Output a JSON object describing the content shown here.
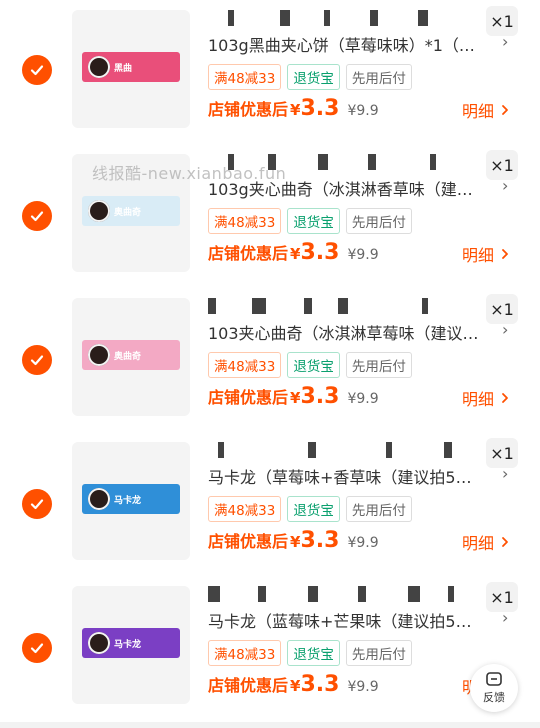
{
  "watermark": "线报酷-new.xianbao.fun",
  "feedback_label": "反馈",
  "items": [
    {
      "title": "103g黑曲夹心饼（草莓味味）*1（…",
      "qty": "×1",
      "tags": [
        "满48减33",
        "退货宝",
        "先用后付"
      ],
      "price_label": "店铺优惠后",
      "price_symbol": "¥",
      "price": "3.3",
      "original_price": "¥9.9",
      "detail": "明细",
      "pack_text": "黑曲",
      "pack_color": "#e94f7a"
    },
    {
      "title": "103g夹心曲奇（冰淇淋香草味（建…",
      "qty": "×1",
      "tags": [
        "满48减33",
        "退货宝",
        "先用后付"
      ],
      "price_label": "店铺优惠后",
      "price_symbol": "¥",
      "price": "3.3",
      "original_price": "¥9.9",
      "detail": "明细",
      "pack_text": "奥曲奇",
      "pack_color": "#d9ecf6"
    },
    {
      "title": "103夹心曲奇（冰淇淋草莓味（建议…",
      "qty": "×1",
      "tags": [
        "满48减33",
        "退货宝",
        "先用后付"
      ],
      "price_label": "店铺优惠后",
      "price_symbol": "¥",
      "price": "3.3",
      "original_price": "¥9.9",
      "detail": "明细",
      "pack_text": "奥曲奇",
      "pack_color": "#f3a9c4"
    },
    {
      "title": "马卡龙（草莓味+香草味（建议拍5…",
      "qty": "×1",
      "tags": [
        "满48减33",
        "退货宝",
        "先用后付"
      ],
      "price_label": "店铺优惠后",
      "price_symbol": "¥",
      "price": "3.3",
      "original_price": "¥9.9",
      "detail": "明细",
      "pack_text": "马卡龙",
      "pack_color": "#2f8fd8"
    },
    {
      "title": "马卡龙（蓝莓味+芒果味（建议拍5…",
      "qty": "×1",
      "tags": [
        "满48减33",
        "退货宝",
        "先用后付"
      ],
      "price_label": "店铺优惠后",
      "price_symbol": "¥",
      "price": "3.3",
      "original_price": "¥9.9",
      "detail": "明细",
      "pack_text": "马卡龙",
      "pack_color": "#7b3fc4"
    }
  ],
  "colors": {
    "accent": "#ff5000",
    "green": "#0aa06e"
  }
}
